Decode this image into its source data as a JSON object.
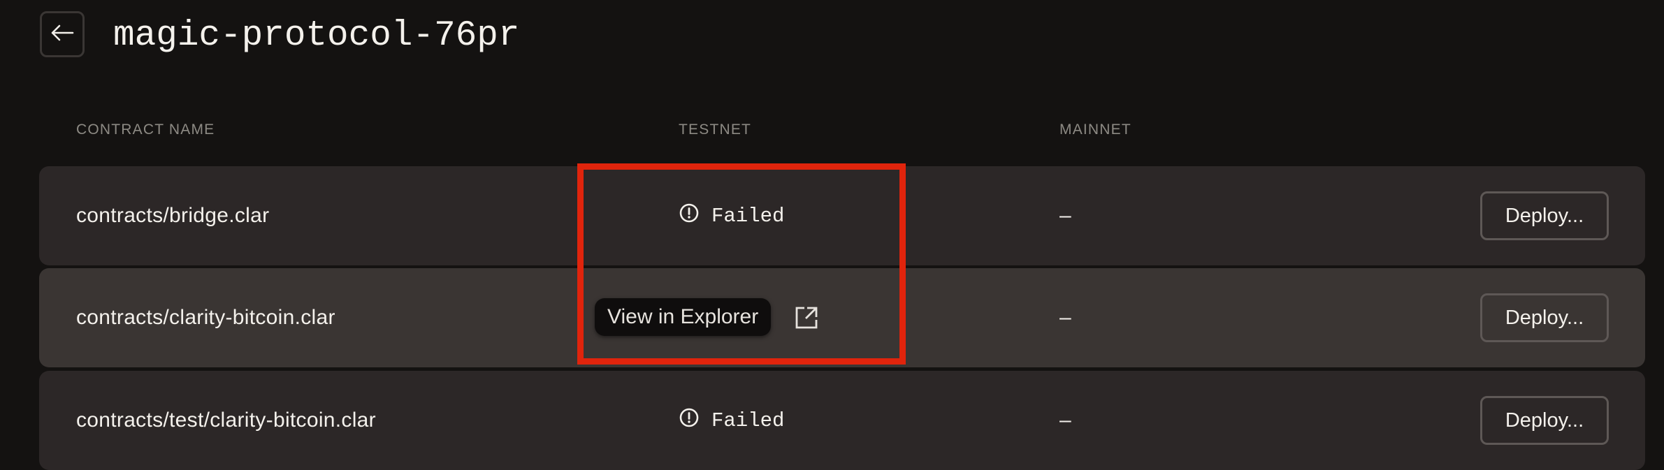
{
  "header": {
    "back_icon": "arrow-left-icon",
    "title": "magic-protocol-76pr"
  },
  "table": {
    "columns": [
      "CONTRACT NAME",
      "TESTNET",
      "MAINNET"
    ],
    "rows": [
      {
        "name": "contracts/bridge.clar",
        "testnet": {
          "status": "Failed",
          "icon": "alert-circle-icon"
        },
        "mainnet": "–",
        "action": "Deploy..."
      },
      {
        "name": "contracts/clarity-bitcoin.clar",
        "testnet": {
          "tooltip": "View in Explorer",
          "icon": "external-link-icon"
        },
        "mainnet": "–",
        "action": "Deploy..."
      },
      {
        "name": "contracts/test/clarity-bitcoin.clar",
        "testnet": {
          "status": "Failed",
          "icon": "alert-circle-icon"
        },
        "mainnet": "–",
        "action": "Deploy..."
      }
    ]
  },
  "colors": {
    "background": "#141211",
    "row": "#2c2727",
    "row_hover": "#3a3533",
    "highlight": "#e0240c",
    "muted_text": "#8d8a84"
  }
}
